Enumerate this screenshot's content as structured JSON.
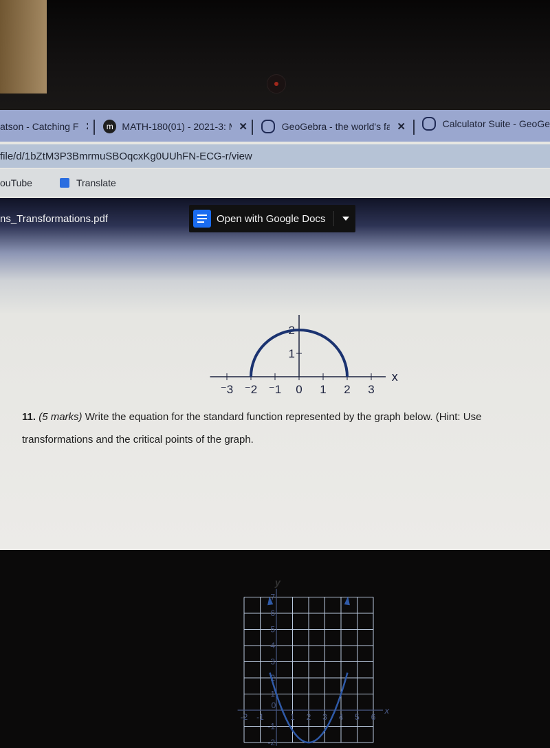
{
  "browser": {
    "tabs": [
      {
        "label": "atson - Catching F",
        "icon": "page-icon",
        "close": "✕"
      },
      {
        "label": "MATH-180(01) - 2021-3: M",
        "icon": "moodle-icon",
        "icon_text": "m",
        "close": "✕"
      },
      {
        "label": "GeoGebra - the world's fa",
        "icon": "geogebra-icon",
        "close": "✕"
      },
      {
        "label": "Calculator Suite - GeoGe",
        "icon": "geogebra-icon"
      }
    ],
    "url": "file/d/1bZtM3P3BmrmuSBOqcxKg0UUhFN-ECG-r/view",
    "bookmarks": [
      {
        "label": "ouTube"
      },
      {
        "label": "Translate",
        "icon": "translate-icon"
      }
    ]
  },
  "viewer": {
    "filename": "ns_Transformations.pdf",
    "open_with_label": "Open with Google Docs",
    "accent": "#1a6cf0"
  },
  "question": {
    "number": "11.",
    "marks": "(5 marks)",
    "text": " Write the equation for the standard function represented by the graph below. (Hint: Use transformations and the critical points of the graph."
  },
  "chart_data": [
    {
      "type": "line",
      "description": "Semicircle (previous question's graph)",
      "x_axis_label": "x",
      "x_ticks": [
        "-3",
        "-2",
        "-1",
        "0",
        "1",
        "2",
        "3"
      ],
      "y_ticks": [
        "1",
        "2"
      ],
      "xlim": [
        -3.5,
        3.5
      ],
      "ylim": [
        0,
        2
      ],
      "curve": "semicircle radius 2 centered at origin",
      "points": [
        [
          -2,
          0
        ],
        [
          0,
          2
        ],
        [
          2,
          0
        ]
      ],
      "color": "#1b3370"
    },
    {
      "type": "line",
      "description": "Parabola with arrows at both ends",
      "x_axis_label": "x",
      "y_axis_label": "y",
      "x_ticks": [
        "-2",
        "-1",
        "0",
        "1",
        "2",
        "3",
        "4",
        "5",
        "6"
      ],
      "y_ticks": [
        "-2",
        "-1",
        "1",
        "2",
        "3",
        "4",
        "5",
        "6",
        "7"
      ],
      "xlim": [
        -2,
        6
      ],
      "ylim": [
        -2,
        7
      ],
      "grid": true,
      "vertex": [
        2,
        -2
      ],
      "points": [
        [
          -0.4,
          7
        ],
        [
          0,
          1
        ],
        [
          2,
          -2
        ],
        [
          4,
          1
        ],
        [
          4.4,
          7
        ]
      ],
      "color": "#2f5aa8"
    }
  ]
}
